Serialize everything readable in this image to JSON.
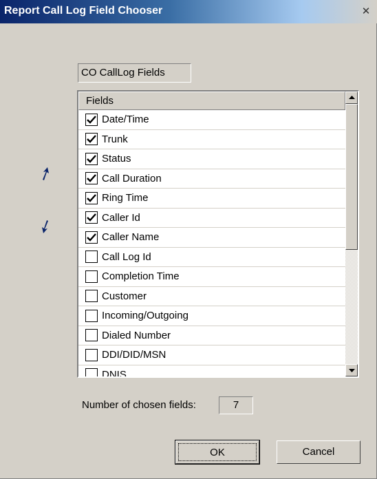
{
  "window": {
    "title": "Report Call Log Field Chooser",
    "close_glyph": "✕"
  },
  "group_label": "CO CallLog Fields",
  "list": {
    "header": "Fields",
    "items": [
      {
        "label": "Date/Time",
        "checked": true
      },
      {
        "label": "Trunk",
        "checked": true
      },
      {
        "label": "Status",
        "checked": true
      },
      {
        "label": "Call Duration",
        "checked": true
      },
      {
        "label": "Ring Time",
        "checked": true
      },
      {
        "label": "Caller Id",
        "checked": true
      },
      {
        "label": "Caller Name",
        "checked": true
      },
      {
        "label": "Call Log Id",
        "checked": false
      },
      {
        "label": "Completion Time",
        "checked": false
      },
      {
        "label": "Customer",
        "checked": false
      },
      {
        "label": "Incoming/Outgoing",
        "checked": false
      },
      {
        "label": "Dialed Number",
        "checked": false
      },
      {
        "label": "DDI/DID/MSN",
        "checked": false
      },
      {
        "label": "DNIS",
        "checked": false
      }
    ]
  },
  "move_up_icon": "arrow-up-icon",
  "move_down_icon": "arrow-down-icon",
  "count": {
    "label": "Number of chosen fields:",
    "value": "7"
  },
  "buttons": {
    "ok": "OK",
    "cancel": "Cancel"
  }
}
